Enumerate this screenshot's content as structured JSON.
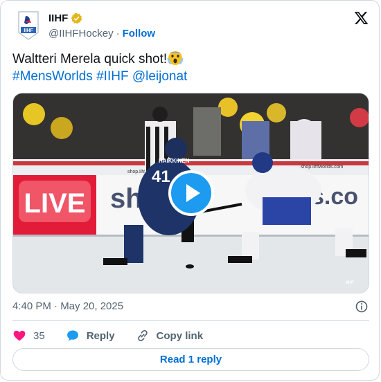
{
  "author": {
    "name": "IIHF",
    "handle": "@IIHFHockey",
    "separator": "·",
    "follow_label": "Follow",
    "verified_color": "#e2b719"
  },
  "tweet": {
    "text_main": "Waltteri Merela quick shot!",
    "hashtag1": "#MensWorlds",
    "hashtag2": "#IIHF",
    "mention": "@leijonat",
    "timestamp": "4:40 PM · May 20, 2025"
  },
  "media": {
    "overlay_live": "LIVE",
    "board_text": "shop.iihfworlds.com",
    "jersey_number": "41",
    "jersey_name": "HAIKKINEN",
    "watermark": "IIHF"
  },
  "actions": {
    "likes": "35",
    "reply_label": "Reply",
    "copy_label": "Copy link"
  },
  "read_replies_label": "Read 1 reply",
  "colors": {
    "link": "#006fd6",
    "like": "#f91880",
    "play": "#1d9bf0",
    "muted": "#536471"
  }
}
